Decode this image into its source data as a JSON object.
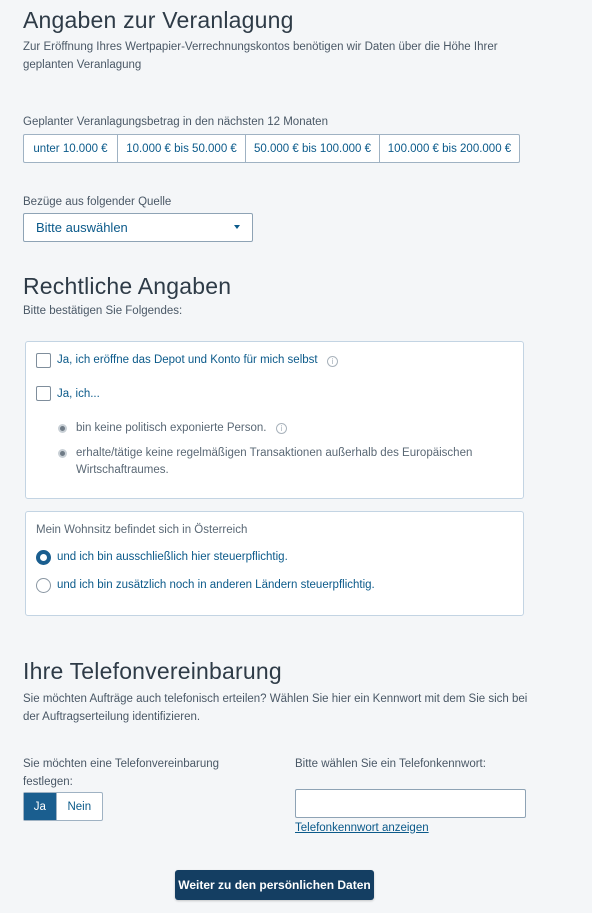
{
  "investment": {
    "title": "Angaben zur Veranlagung",
    "description": "Zur Eröffnung Ihres Wertpapier-Verrechnungskontos benötigen wir Daten über die Höhe Ihrer geplanten Veranlagung",
    "amount_label": "Geplanter Veranlagungsbetrag in den nächsten 12 Monaten",
    "amount_options": [
      "unter 10.000 €",
      "10.000 € bis 50.000 €",
      "50.000 € bis 100.000 €",
      "100.000 € bis 200.000 €"
    ],
    "source_label": "Bezüge aus folgender Quelle",
    "source_selected": "Bitte auswählen"
  },
  "legal": {
    "title": "Rechtliche Angaben",
    "subtitle": "Bitte bestätigen Sie Folgendes:",
    "checkbox_self": "Ja, ich eröffne das Depot und Konto für mich selbst",
    "checkbox_ich": "Ja, ich...",
    "bullet_1": "bin keine politisch exponierte Person.",
    "bullet_2": "erhalte/tätige keine regelmäßigen Transaktionen außerhalb des Europäischen Wirtschaftraumes.",
    "residence_label": "Mein Wohnsitz befindet sich in Österreich",
    "radio_1": "und ich bin ausschließlich hier steuerpflichtig.",
    "radio_2": "und ich bin zusätzlich noch in anderen Ländern steuerpflichtig.",
    "radio_selected": 0
  },
  "phone": {
    "title": "Ihre Telefonvereinbarung",
    "description": "Sie möchten Aufträge auch telefonisch erteilen? Wählen Sie hier ein Kennwort mit dem Sie sich bei der Auftragserteilung identifizieren.",
    "agreement_label": "Sie möchten eine Telefonvereinbarung festlegen:",
    "yes_label": "Ja",
    "no_label": "Nein",
    "password_label": "Bitte wählen Sie ein Telefonkennwort:",
    "password_value": "",
    "show_password_link": "Telefonkennwort anzeigen"
  },
  "submit_label": "Weiter zu den persönlichen Daten",
  "colors": {
    "accent": "#1a5e8f",
    "button": "#143e62",
    "link": "#0b5a8a"
  }
}
